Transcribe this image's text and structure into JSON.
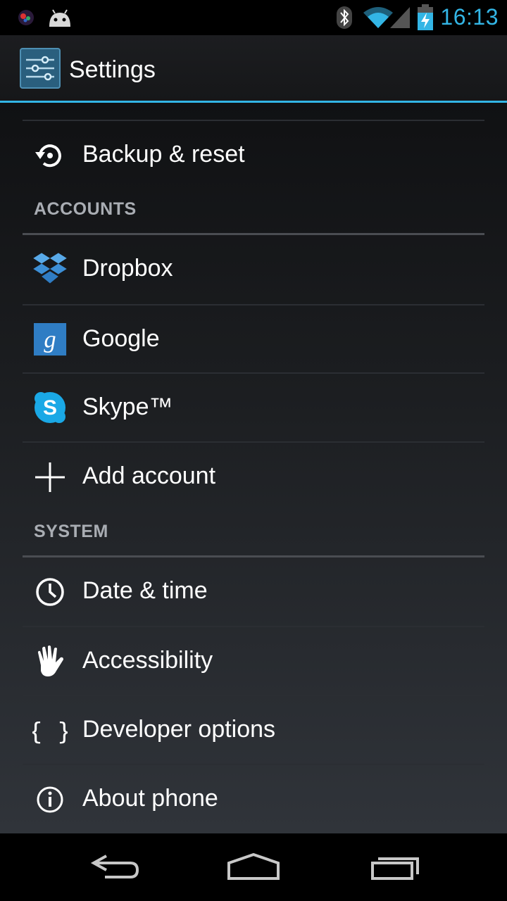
{
  "status_bar": {
    "time": "16:13",
    "icons": [
      "notification-app-icon",
      "android-icon",
      "bluetooth-icon",
      "wifi-icon",
      "cell-signal-icon",
      "battery-charging-icon"
    ]
  },
  "action_bar": {
    "title": "Settings",
    "icon": "settings-sliders-icon"
  },
  "list": {
    "backup": {
      "label": "Backup & reset",
      "icon": "backup-reset-icon"
    },
    "accounts_header": "ACCOUNTS",
    "accounts": [
      {
        "label": "Dropbox",
        "icon": "dropbox-icon"
      },
      {
        "label": "Google",
        "icon": "google-icon"
      },
      {
        "label": "Skype™",
        "icon": "skype-icon"
      },
      {
        "label": "Add account",
        "icon": "plus-icon"
      }
    ],
    "system_header": "SYSTEM",
    "system": [
      {
        "label": "Date & time",
        "icon": "clock-icon"
      },
      {
        "label": "Accessibility",
        "icon": "hand-icon"
      },
      {
        "label": "Developer options",
        "icon": "braces-icon"
      },
      {
        "label": "About phone",
        "icon": "info-icon"
      }
    ]
  },
  "nav_bar": {
    "buttons": [
      "back-icon",
      "home-icon",
      "recents-icon"
    ]
  },
  "colors": {
    "accent": "#33b5e5",
    "header_text": "#a9adb3",
    "background_top": "#101113",
    "background_bottom": "#30343a"
  }
}
